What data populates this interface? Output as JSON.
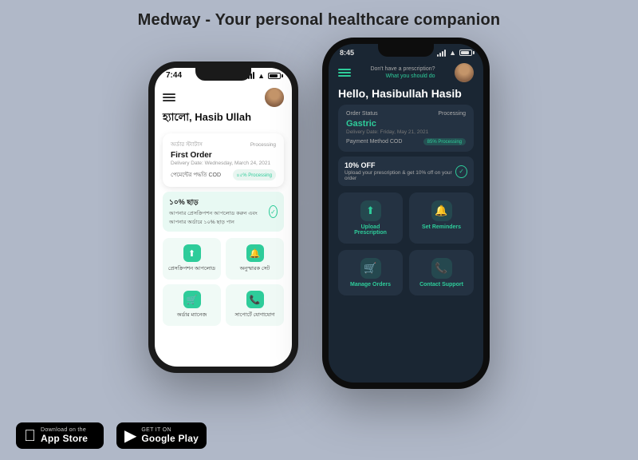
{
  "page": {
    "title": "Medway - Your personal healthcare companion",
    "background": "#b0b8c8"
  },
  "phone_light": {
    "status_time": "7:44",
    "greeting": "হ্যালো, Hasib Ullah",
    "order_label": "অর্ডার স্ট্যাটাস",
    "order_status": "Processing",
    "order_name": "First Order",
    "order_date": "Delivery Date: Wednesday, March 24, 2021",
    "order_method": "পেমেন্টের পদ্ধতি COD",
    "order_pill": "৪৫% Processing",
    "promo_main": "১০% ছাড়",
    "promo_sub": "আপনার প্রেসক্রিপশন আপলোড করুন এবং আপনার অর্ডারে ১০% ছাড় পান",
    "btn1_label": "প্রেসক্রিপশন আপলোড",
    "btn2_label": "অনুস্মারক সেট",
    "btn3_label": "অর্ডার ম্যানেজ",
    "btn4_label": "সাপোর্টে যোগাযোগ"
  },
  "phone_dark": {
    "status_time": "8:45",
    "prompt_line1": "Don't have a prescription?",
    "prompt_line2": "What you should do",
    "greeting": "Hello, Hasibullah Hasib",
    "order_label": "Order Status",
    "order_status": "Processing",
    "order_name": "Gastric",
    "order_date": "Delivery Date: Friday, May 21, 2021",
    "order_method": "Payment Method COD",
    "order_pill": "85% Processing",
    "promo_main": "10% OFF",
    "promo_sub": "Upload your prescription & get 10% off on your order",
    "btn1_label": "Upload Prescription",
    "btn2_label": "Set Reminders",
    "btn3_label": "Manage Orders",
    "btn4_label": "Contact Support"
  },
  "badges": {
    "appstore_top": "Download on the",
    "appstore_bottom": "App Store",
    "googleplay_top": "GET IT ON",
    "googleplay_bottom": "Google Play"
  }
}
